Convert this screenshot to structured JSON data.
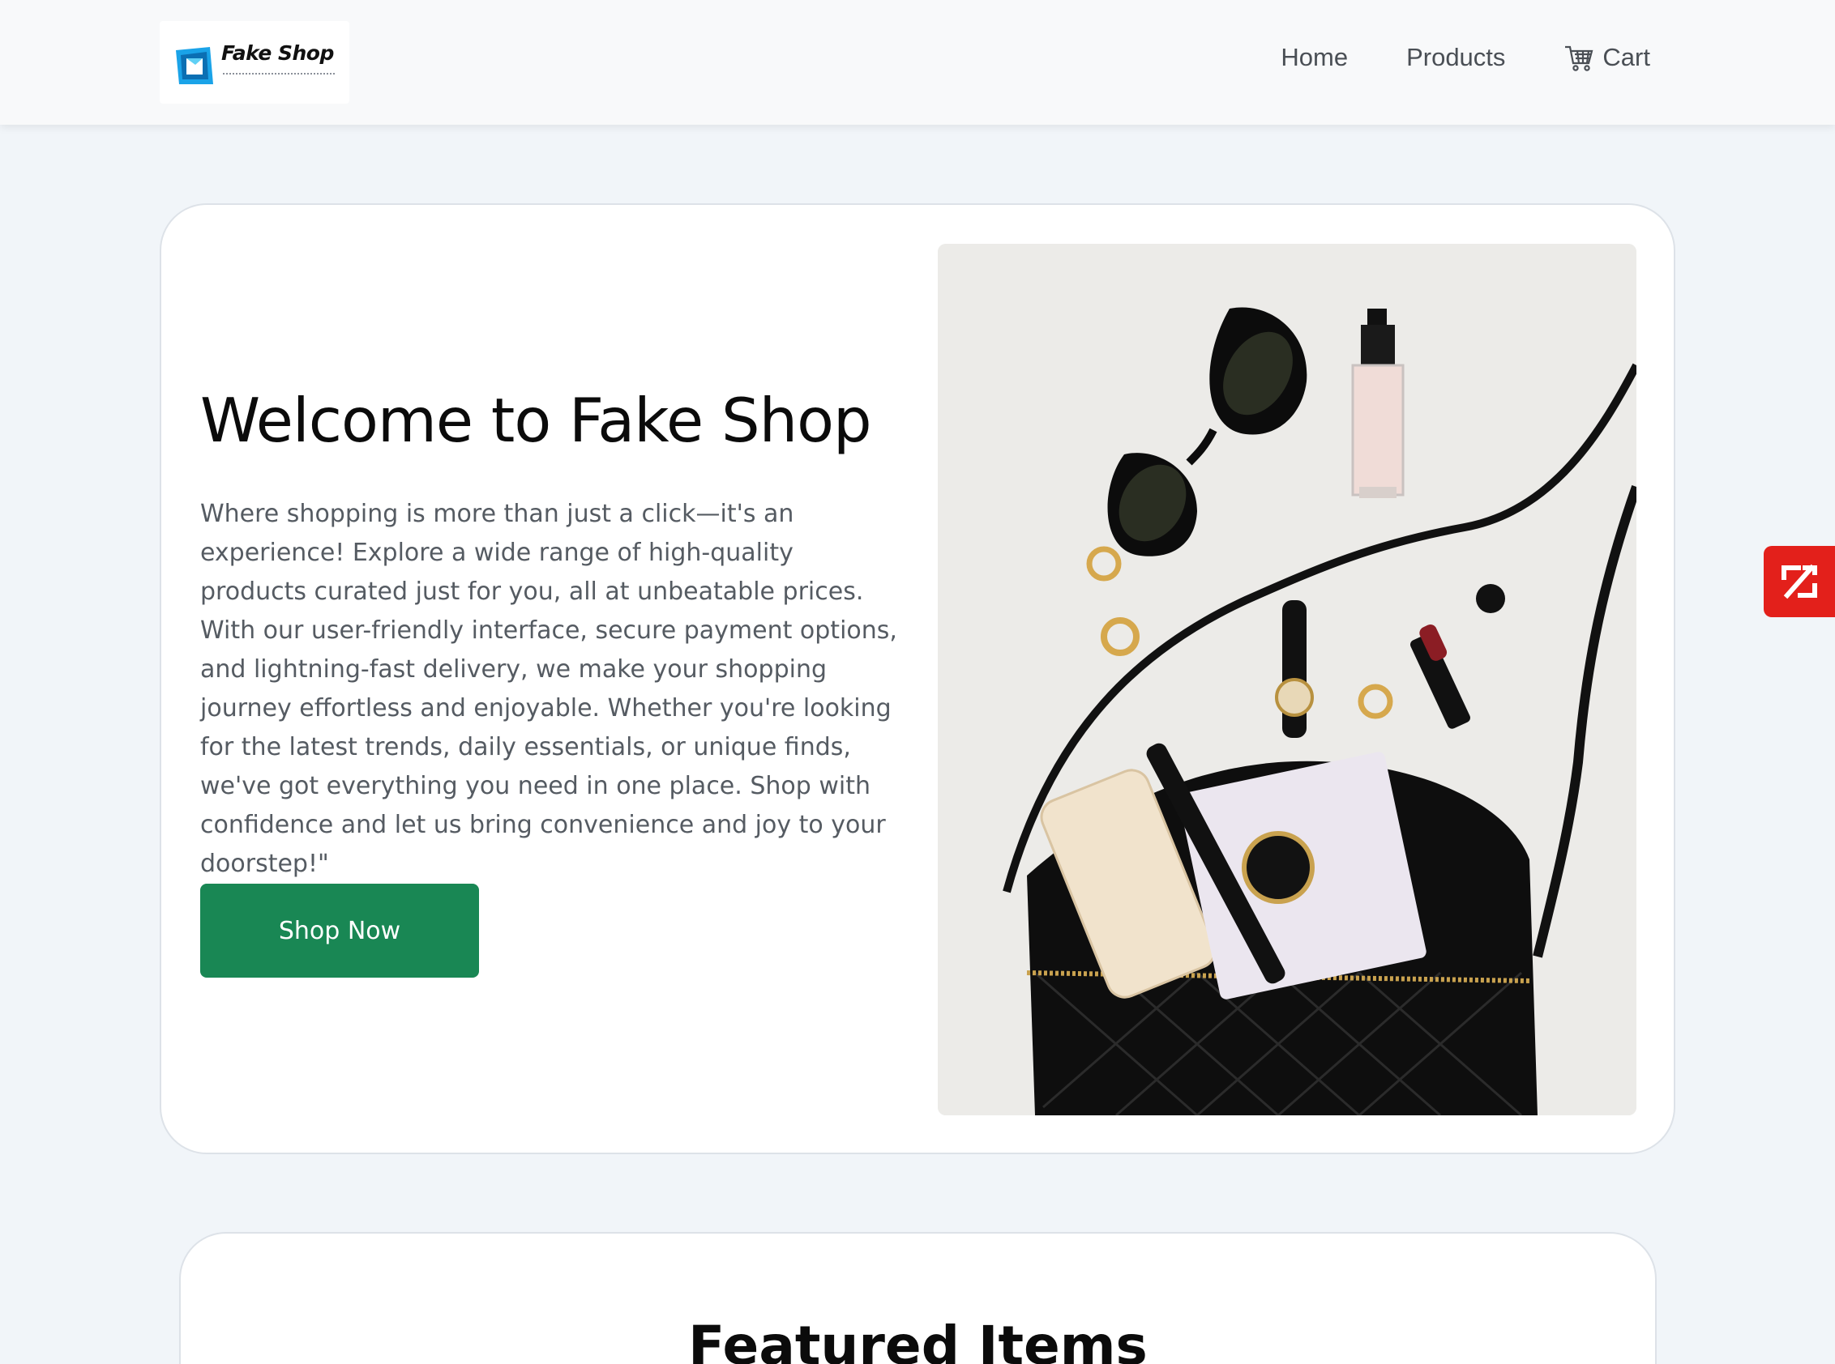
{
  "navbar": {
    "brand": "Fake Shop",
    "links": [
      {
        "label": "Home",
        "icon": null
      },
      {
        "label": "Products",
        "icon": null
      },
      {
        "label": "Cart",
        "icon": "shopping-cart-icon"
      }
    ]
  },
  "hero": {
    "title": "Welcome to Fake Shop",
    "description": "Where shopping is more than just a click—it's an experience! Explore a wide range of high-quality products curated just for you, all at unbeatable prices. With our user-friendly interface, secure payment options, and lightning-fast delivery, we make your shopping journey effortless and enjoyable. Whether you're looking for the latest trends, daily essentials, or unique finds, we've got everything you need in one place. Shop with confidence and let us bring convenience and joy to your doorstep!\"",
    "cta_label": "Shop Now",
    "image_alt": "flat-lay of black handbag, sunglasses, watch, phone, lipstick and rings"
  },
  "featured": {
    "title": "Featured Items"
  },
  "side_widget": {
    "icon": "zoho-z-icon"
  },
  "colors": {
    "navbar_bg": "#f8f9fa",
    "page_bg": "#f1f5f9",
    "cta_green": "#198754",
    "widget_red": "#e3201b",
    "logo_blue": "#1aa3e8"
  }
}
